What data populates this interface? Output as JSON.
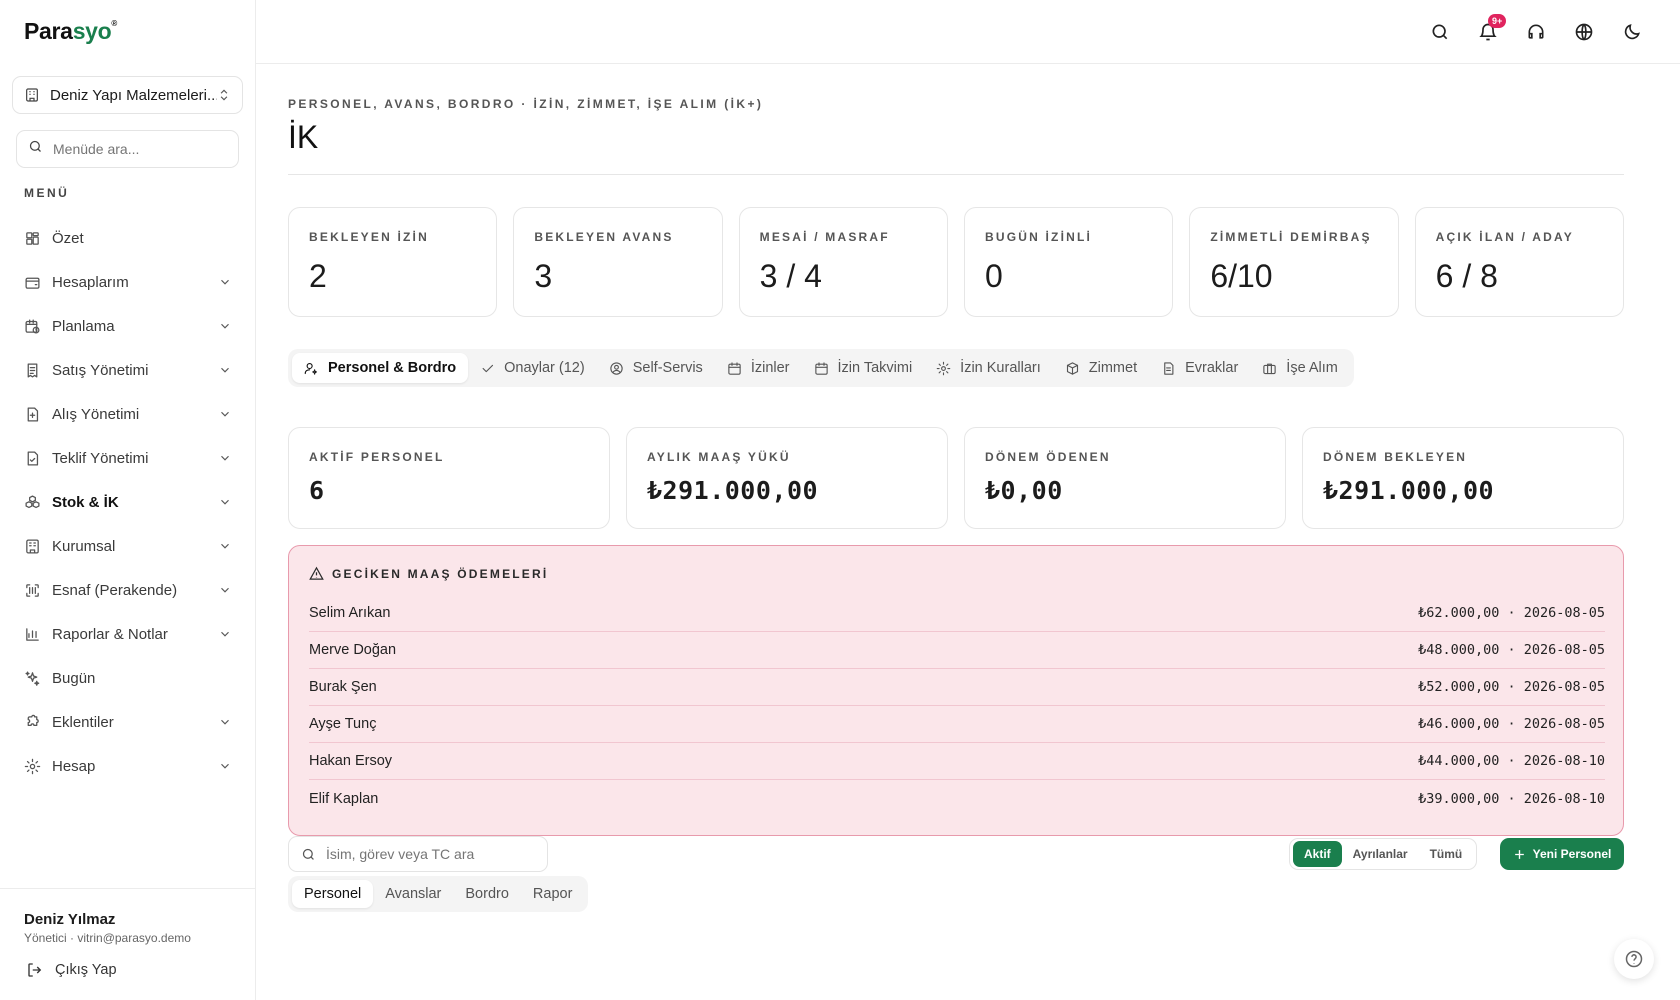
{
  "app": {
    "logo_main": "Para",
    "logo_accent": "syo",
    "logo_mark": "®"
  },
  "sidebar": {
    "company": "Deniz Yapı Malzemeleri...",
    "search_placeholder": "Menüde ara...",
    "menu_label": "MENÜ",
    "items": [
      {
        "label": "Özet",
        "icon": "grid-icon",
        "has_chevron": false
      },
      {
        "label": "Hesaplarım",
        "icon": "wallet-icon",
        "has_chevron": true
      },
      {
        "label": "Planlama",
        "icon": "calendar-clock-icon",
        "has_chevron": true
      },
      {
        "label": "Satış Yönetimi",
        "icon": "receipt-icon",
        "has_chevron": true
      },
      {
        "label": "Alış Yönetimi",
        "icon": "file-plus-icon",
        "has_chevron": true
      },
      {
        "label": "Teklif Yönetimi",
        "icon": "file-check-icon",
        "has_chevron": true
      },
      {
        "label": "Stok & İK",
        "icon": "boxes-icon",
        "has_chevron": true
      },
      {
        "label": "Kurumsal",
        "icon": "building-icon",
        "has_chevron": true
      },
      {
        "label": "Esnaf (Perakende)",
        "icon": "scan-icon",
        "has_chevron": true
      },
      {
        "label": "Raporlar & Notlar",
        "icon": "bar-chart-icon",
        "has_chevron": true
      },
      {
        "label": "Bugün",
        "icon": "sparkles-icon",
        "has_chevron": false
      },
      {
        "label": "Eklentiler",
        "icon": "puzzle-icon",
        "has_chevron": true
      },
      {
        "label": "Hesap",
        "icon": "gear-icon",
        "has_chevron": true
      }
    ],
    "active_index": 6,
    "user": {
      "name": "Deniz Yılmaz",
      "meta": "Yönetici · vitrin@parasyo.demo",
      "logout": "Çıkış Yap"
    }
  },
  "topbar": {
    "notification_badge": "9+"
  },
  "page": {
    "eyebrow": "PERSONEL, AVANS, BORDRO · İZİN, ZİMMET, İŞE ALIM (İK+)",
    "title": "İK",
    "stats": [
      {
        "label": "BEKLEYEN İZİN",
        "value": "2"
      },
      {
        "label": "BEKLEYEN AVANS",
        "value": "3"
      },
      {
        "label": "MESAİ / MASRAF",
        "value": "3 / 4"
      },
      {
        "label": "BUGÜN İZİNLİ",
        "value": "0"
      },
      {
        "label": "ZİMMETLİ DEMİRBAŞ",
        "value": "6/10"
      },
      {
        "label": "AÇIK İLAN / ADAY",
        "value": "6 / 8"
      }
    ],
    "tabs": [
      {
        "label": "Personel & Bordro",
        "icon": "user-gear-icon"
      },
      {
        "label": "Onaylar (12)",
        "icon": "check-icon"
      },
      {
        "label": "Self-Servis",
        "icon": "user-circle-icon"
      },
      {
        "label": "İzinler",
        "icon": "calendar-icon"
      },
      {
        "label": "İzin Takvimi",
        "icon": "calendar-icon"
      },
      {
        "label": "İzin Kuralları",
        "icon": "gear-icon"
      },
      {
        "label": "Zimmet",
        "icon": "package-icon"
      },
      {
        "label": "Evraklar",
        "icon": "document-icon"
      },
      {
        "label": "İşe Alım",
        "icon": "briefcase-icon"
      }
    ],
    "active_tab": 0,
    "summary": [
      {
        "label": "AKTİF PERSONEL",
        "value": "6"
      },
      {
        "label": "AYLIK MAAŞ YÜKÜ",
        "value": "₺291.000,00"
      },
      {
        "label": "DÖNEM ÖDENEN",
        "value": "₺0,00"
      },
      {
        "label": "DÖNEM BEKLEYEN",
        "value": "₺291.000,00"
      }
    ],
    "late_payments": {
      "title": "GECİKEN MAAŞ ÖDEMELERİ",
      "rows": [
        {
          "name": "Selim Arıkan",
          "detail": "₺62.000,00 · 2026-08-05"
        },
        {
          "name": "Merve Doğan",
          "detail": "₺48.000,00 · 2026-08-05"
        },
        {
          "name": "Burak Şen",
          "detail": "₺52.000,00 · 2026-08-05"
        },
        {
          "name": "Ayşe Tunç",
          "detail": "₺46.000,00 · 2026-08-05"
        },
        {
          "name": "Hakan Ersoy",
          "detail": "₺44.000,00 · 2026-08-10"
        },
        {
          "name": "Elif Kaplan",
          "detail": "₺39.000,00 · 2026-08-10"
        }
      ]
    },
    "subtabs": [
      "Personel",
      "Avanslar",
      "Bordro",
      "Rapor"
    ],
    "active_subtab": 0,
    "staff_search_placeholder": "İsim, görev veya TC ara",
    "filters": [
      "Aktif",
      "Ayrılanlar",
      "Tümü"
    ],
    "active_filter": 0,
    "new_button": "Yeni Personel"
  },
  "colors": {
    "brand": "#1a7f4d",
    "alert_bg": "#fbe6ea",
    "alert_border": "#e89aac",
    "badge": "#e0245e"
  }
}
